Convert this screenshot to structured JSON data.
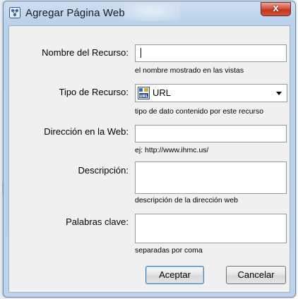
{
  "window": {
    "title": "Agregar Página Web",
    "close_label": "x"
  },
  "form": {
    "resource_name": {
      "label": "Nombre del Recurso:",
      "value": "",
      "hint": "el nombre mostrado en las vistas"
    },
    "resource_type": {
      "label": "Tipo de Recurso:",
      "selected": "URL",
      "icon": "url-icon",
      "hint": "tipo de dato contenido por este recurso"
    },
    "web_address": {
      "label": "Dirección en la Web:",
      "value": "",
      "hint": "ej: http://www.ihmc.us/"
    },
    "description": {
      "label": "Descripción:",
      "value": "",
      "hint": "descripción de la dirección web"
    },
    "keywords": {
      "label": "Palabras clave:",
      "value": "",
      "hint": "separadas por coma"
    }
  },
  "buttons": {
    "accept": "Aceptar",
    "cancel": "Cancelar"
  },
  "colors": {
    "title_bar": "#bcd3eb",
    "close_button": "#c9432b",
    "client_bg": "#f0f0f0",
    "primary_button_border": "#3c7fb1"
  }
}
